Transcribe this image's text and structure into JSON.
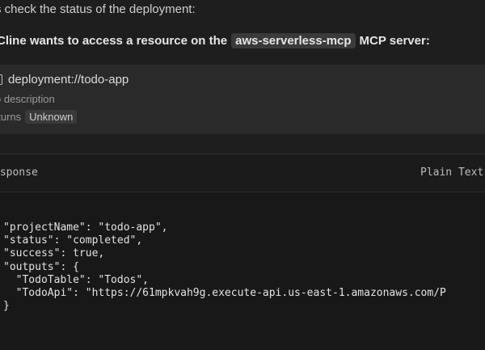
{
  "intro_text": "s check the status of the deployment:",
  "mcp_request": {
    "prefix": "Cline wants to access a resource on the",
    "server_name": "aws-serverless-mcp",
    "suffix": "MCP server:"
  },
  "resource": {
    "uri": "deployment://todo-app",
    "description": "o description",
    "returns_label": "eturns",
    "returns_type": "Unknown"
  },
  "response": {
    "title": "esponse",
    "format": "Plain Text",
    "code_lines": [
      "\"projectName\": \"todo-app\",",
      "\"status\": \"completed\",",
      "\"success\": true,",
      "\"outputs\": {",
      "  \"TodoTable\": \"Todos\",",
      "  \"TodoApi\": \"https://61mpkvah9g.execute-api.us-east-1.amazonaws.com/P",
      "}"
    ]
  },
  "icons": {
    "resource": "file-icon"
  }
}
